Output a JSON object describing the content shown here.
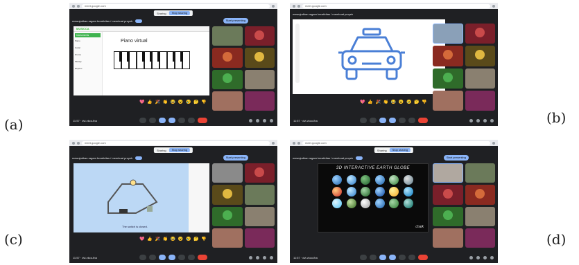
{
  "labels": {
    "a": "(a)",
    "b": "(b)",
    "c": "(c)",
    "d": "(d)"
  },
  "common": {
    "url": "meet.google.com",
    "sharing_text": "Sharing",
    "stop_sharing": "Stop sharing",
    "meeting_title": "mewujudkan ragam kreativitas / membuat proyek",
    "present_now": "Start presenting",
    "clock": "11:57  ·  dvi-vkco-fba",
    "reactions": "💖 👍 🎉 👏 😂 😮 😢 🤔 👎"
  },
  "panel_a": {
    "app_name": "MUSICCA",
    "side_title": "Instruments",
    "side_items": [
      "Piano",
      "Guitar",
      "Drums",
      "Melody",
      "Rhythm"
    ],
    "piano_title": "Piano virtual"
  },
  "panel_c": {
    "caption": "The switch is closed."
  },
  "panel_d": {
    "globe_title": "3D INTERACTIVE EARTH GLOBE",
    "brand": "chalk"
  },
  "colors": {
    "meet_bg": "#1f2023",
    "accent": "#8ab4f8",
    "end_call": "#ea4335",
    "music_green": "#3fb34f",
    "car_blue": "#4a7fd6"
  }
}
